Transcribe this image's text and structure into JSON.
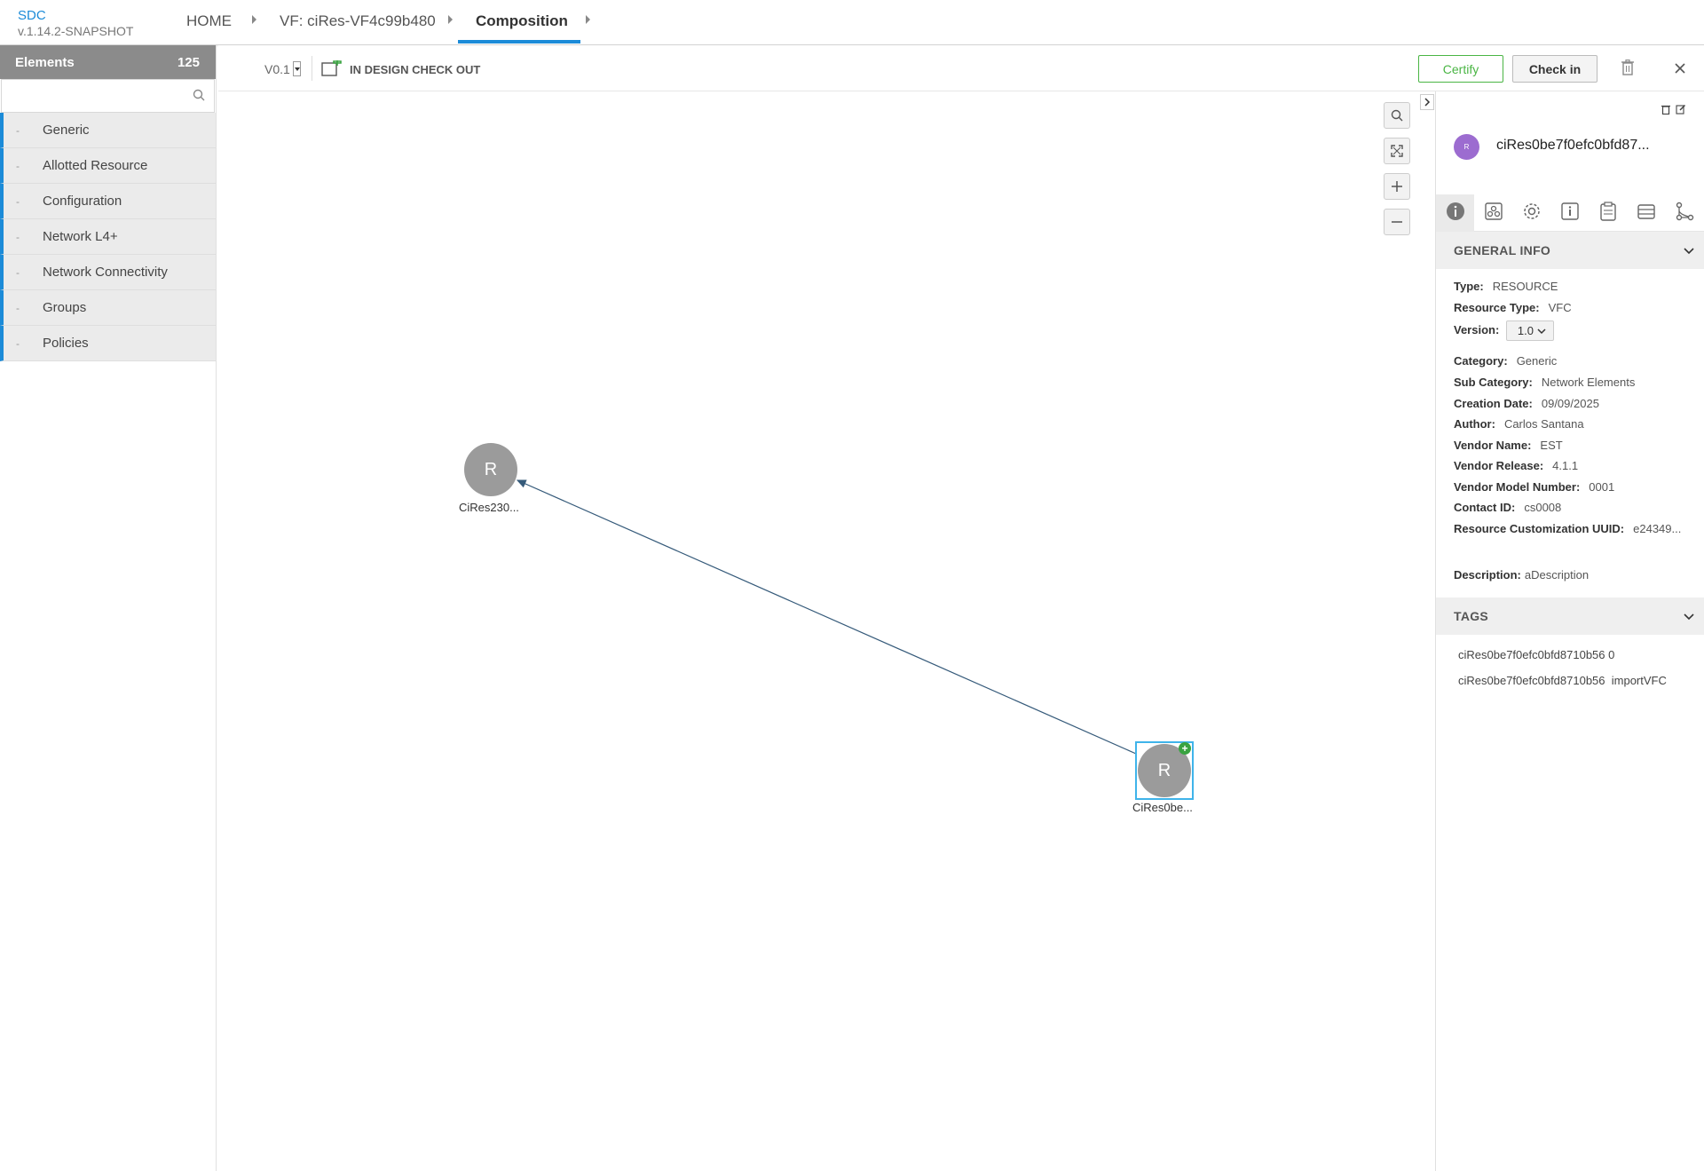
{
  "app": {
    "name": "SDC",
    "version": "v.1.14.2-SNAPSHOT"
  },
  "breadcrumb": [
    {
      "label": "HOME"
    },
    {
      "label": "VF: ciRes-VF4c99b480"
    },
    {
      "label": "Composition"
    }
  ],
  "sidebar": {
    "title": "Elements",
    "count": "125",
    "search_placeholder": "",
    "items": [
      {
        "dash": "-",
        "label": "Generic"
      },
      {
        "dash": "-",
        "label": "Allotted Resource"
      },
      {
        "dash": "-",
        "label": "Configuration"
      },
      {
        "dash": "-",
        "label": "Network L4+"
      },
      {
        "dash": "-",
        "label": "Network Connectivity"
      },
      {
        "dash": "-",
        "label": "Groups"
      },
      {
        "dash": "-",
        "label": "Policies"
      }
    ]
  },
  "toolbar": {
    "version": "V0.1",
    "status": "IN DESIGN CHECK OUT",
    "certify_label": "Certify",
    "checkin_label": "Check in"
  },
  "canvas": {
    "nodes": [
      {
        "letter": "R",
        "label": "CiRes230...",
        "selected": false
      },
      {
        "letter": "R",
        "label": "CiRes0be...",
        "selected": true,
        "badge": "+"
      }
    ],
    "zoom_controls": [
      "search-icon",
      "fit-icon",
      "zoom-in-icon",
      "zoom-out-icon"
    ]
  },
  "details": {
    "avatar_letter": "R",
    "title": "ciRes0be7f0efc0bfd87...",
    "tabs": [
      "info-icon",
      "deployment-icon",
      "settings-icon",
      "attributes-icon",
      "clipboard-icon",
      "archive-icon",
      "relations-icon"
    ],
    "general_info": {
      "header": "GENERAL INFO",
      "type_key": "Type:",
      "type_val": "RESOURCE",
      "rtype_key": "Resource Type:",
      "rtype_val": "VFC",
      "version_key": "Version:",
      "version_val": "1.0",
      "category_key": "Category:",
      "category_val": "Generic",
      "subcat_key": "Sub Category:",
      "subcat_val": "Network Elements",
      "created_key": "Creation Date:",
      "created_val": "09/09/2025",
      "author_key": "Author:",
      "author_val": "Carlos Santana",
      "vendor_key": "Vendor Name:",
      "vendor_val": "EST",
      "vrel_key": "Vendor Release:",
      "vrel_val": "4.1.1",
      "vmodel_key": "Vendor Model Number:",
      "vmodel_val": "0001",
      "contact_key": "Contact ID:",
      "contact_val": "cs0008",
      "uuid_key": "Resource Customization UUID:",
      "uuid_val": "e24349...",
      "desc_key": "Description:",
      "desc_val": "aDescription"
    },
    "tags": {
      "header": "TAGS",
      "items": [
        "ciRes0be7f0efc0bfd8710b56 0",
        "ciRes0be7f0efc0bfd8710b56  importVFC"
      ]
    }
  },
  "colors": {
    "accent": "#1c8bd8",
    "certify": "#4ab544",
    "node": "#9b9b9b",
    "avatar": "#9c6cd0",
    "selection": "#3fb4ea"
  }
}
